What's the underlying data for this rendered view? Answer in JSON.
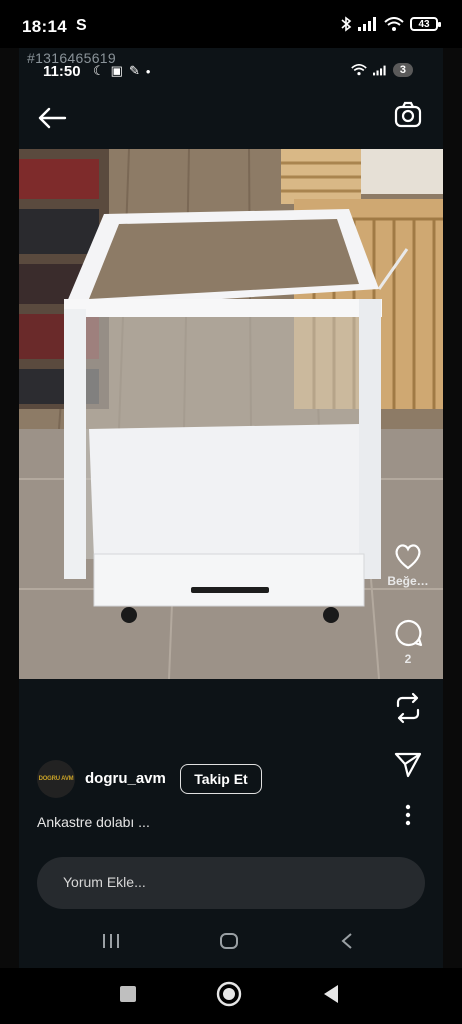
{
  "outer_status": {
    "time": "18:14",
    "app_indicator": "S",
    "battery": "43",
    "icons": [
      "bluetooth-icon",
      "signal-icon",
      "wifi-icon",
      "battery-icon"
    ]
  },
  "inner_status": {
    "code": "#1316465619",
    "time": "11:50",
    "notification_count": "3"
  },
  "header": {
    "back_icon": "arrow-left-icon",
    "camera_icon": "camera-icon"
  },
  "rail": {
    "like_label": "Beğe…",
    "comment_count": "2"
  },
  "post": {
    "avatar_text": "DOGRU AVM",
    "username": "dogru_avm",
    "follow_label": "Takip Et",
    "caption": "Ankastre dolabı ..."
  },
  "comment": {
    "placeholder": "Yorum Ekle..."
  },
  "colors": {
    "background": "#0d1317",
    "comment_box": "#262a2e",
    "accent_text": "#ffffff"
  }
}
